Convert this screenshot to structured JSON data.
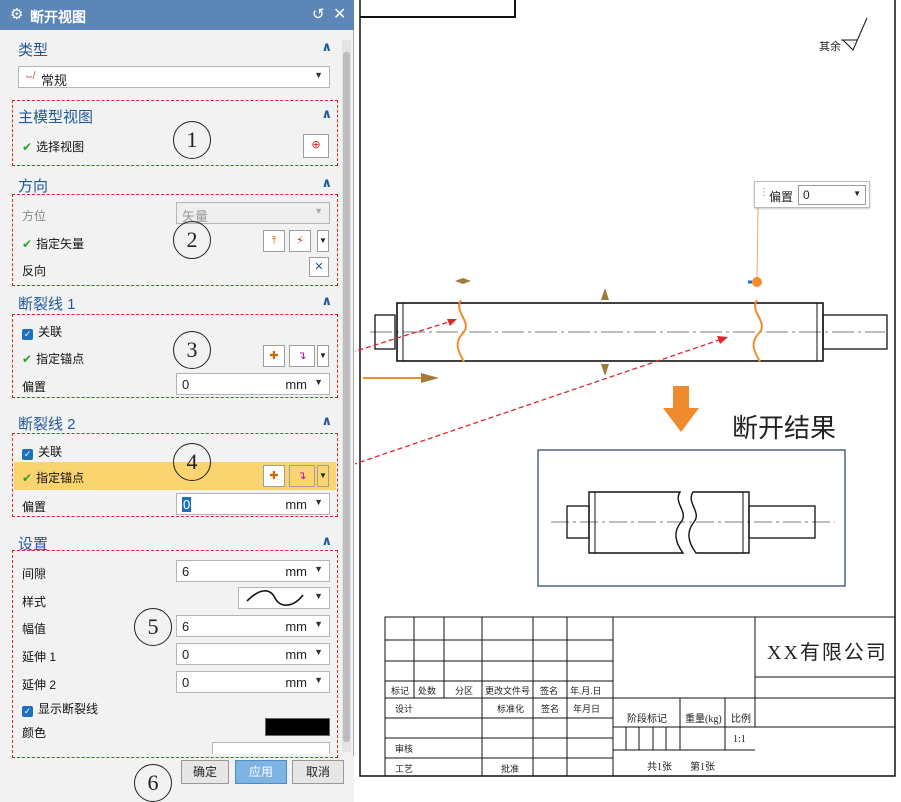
{
  "dialog": {
    "title": "断开视图",
    "sections": {
      "type": {
        "title": "类型",
        "value": "常规"
      },
      "main_view": {
        "title": "主模型视图",
        "select_view": "选择视图"
      },
      "direction": {
        "title": "方向",
        "orientation_label": "方位",
        "orientation_value": "矢量",
        "vector_label": "指定矢量",
        "reverse_label": "反向"
      },
      "break1": {
        "title": "断裂线 1",
        "associative": "关联",
        "anchor_label": "指定锚点",
        "offset_label": "偏置",
        "offset_value": "0",
        "unit": "mm"
      },
      "break2": {
        "title": "断裂线 2",
        "associative": "关联",
        "anchor_label": "指定锚点",
        "offset_label": "偏置",
        "offset_value": "0",
        "unit": "mm"
      },
      "settings": {
        "title": "设置",
        "gap_label": "间隙",
        "gap_value": "6",
        "style_label": "样式",
        "amplitude_label": "幅值",
        "amplitude_value": "6",
        "ext1_label": "延伸 1",
        "ext1_value": "0",
        "ext2_label": "延伸 2",
        "ext2_value": "0",
        "show_break_label": "显示断裂线",
        "color_label": "颜色",
        "unit": "mm"
      }
    },
    "buttons": {
      "ok": "确定",
      "apply": "应用",
      "cancel": "取消"
    }
  },
  "callouts": [
    "1",
    "2",
    "3",
    "4",
    "5",
    "6"
  ],
  "drawing": {
    "offset_popup": {
      "label": "偏置",
      "value": "0"
    },
    "result_label": "断开结果",
    "surface_note": "其余",
    "company": "XX有限公司",
    "title_block": {
      "headers": [
        "标记",
        "处数",
        "分区",
        "更改文件号",
        "签名",
        "年.月.日"
      ],
      "design": "设计",
      "standardize": "标准化",
      "review": "审核",
      "process": "工艺",
      "approve": "批准",
      "stage_mark": "阶段标记",
      "weight": "重量(kg)",
      "scale": "比例",
      "scale_value": "1:1",
      "sheets_total": "共1张",
      "sheet_no": "第1张",
      "signature": "签名",
      "date": "年月日"
    }
  },
  "colors": {
    "title_bar": "#5b86b6",
    "section_title": "#1f5a96",
    "highlight": "#fad56f",
    "red_dash": "#e0252c",
    "orange": "#f28c28",
    "apply": "#7db4e4"
  }
}
